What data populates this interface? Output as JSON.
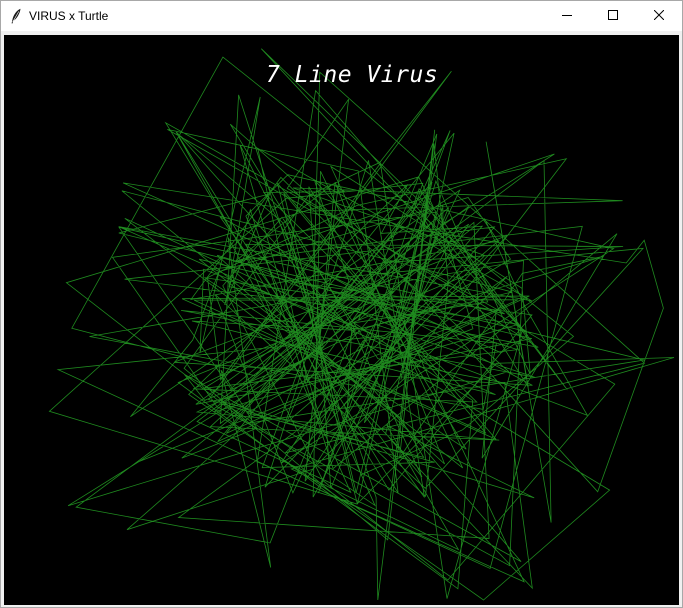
{
  "window": {
    "title": "VIRUS x Turtle",
    "controls": {
      "minimize_icon": "minimize-icon",
      "maximize_icon": "maximize-icon",
      "close_icon": "close-icon"
    }
  },
  "canvas": {
    "background_color": "#000000",
    "stroke_color": "#1f8a1f",
    "title": "7 Line Virus"
  }
}
